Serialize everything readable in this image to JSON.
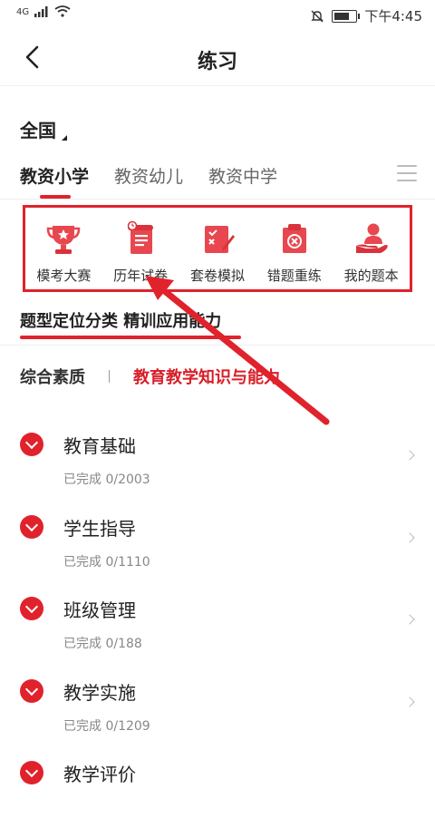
{
  "status": {
    "network": "4G",
    "time": "下午4:45"
  },
  "header": {
    "title": "练习"
  },
  "region": {
    "label": "全国"
  },
  "tabs": [
    {
      "label": "教资小学",
      "active": true
    },
    {
      "label": "教资幼儿",
      "active": false
    },
    {
      "label": "教资中学",
      "active": false
    }
  ],
  "features": [
    {
      "label": "模考大赛",
      "icon": "trophy-icon"
    },
    {
      "label": "历年试卷",
      "icon": "scroll-icon"
    },
    {
      "label": "套卷模拟",
      "icon": "exam-paper-icon"
    },
    {
      "label": "错题重练",
      "icon": "wrong-question-icon"
    },
    {
      "label": "我的题本",
      "icon": "user-book-icon"
    }
  ],
  "section": {
    "title": "题型定位分类 精训应用能力"
  },
  "subtabs": [
    {
      "label": "综合素质"
    },
    {
      "label": "教育教学知识与能力"
    }
  ],
  "items": [
    {
      "name": "教育基础",
      "progress": "已完成 0/2003"
    },
    {
      "name": "学生指导",
      "progress": "已完成 0/1110"
    },
    {
      "name": "班级管理",
      "progress": "已完成 0/188"
    },
    {
      "name": "教学实施",
      "progress": "已完成 0/1209"
    },
    {
      "name": "教学评价",
      "progress": ""
    }
  ],
  "colors": {
    "accent": "#e0222c",
    "subtab_active": "#d81e28"
  }
}
